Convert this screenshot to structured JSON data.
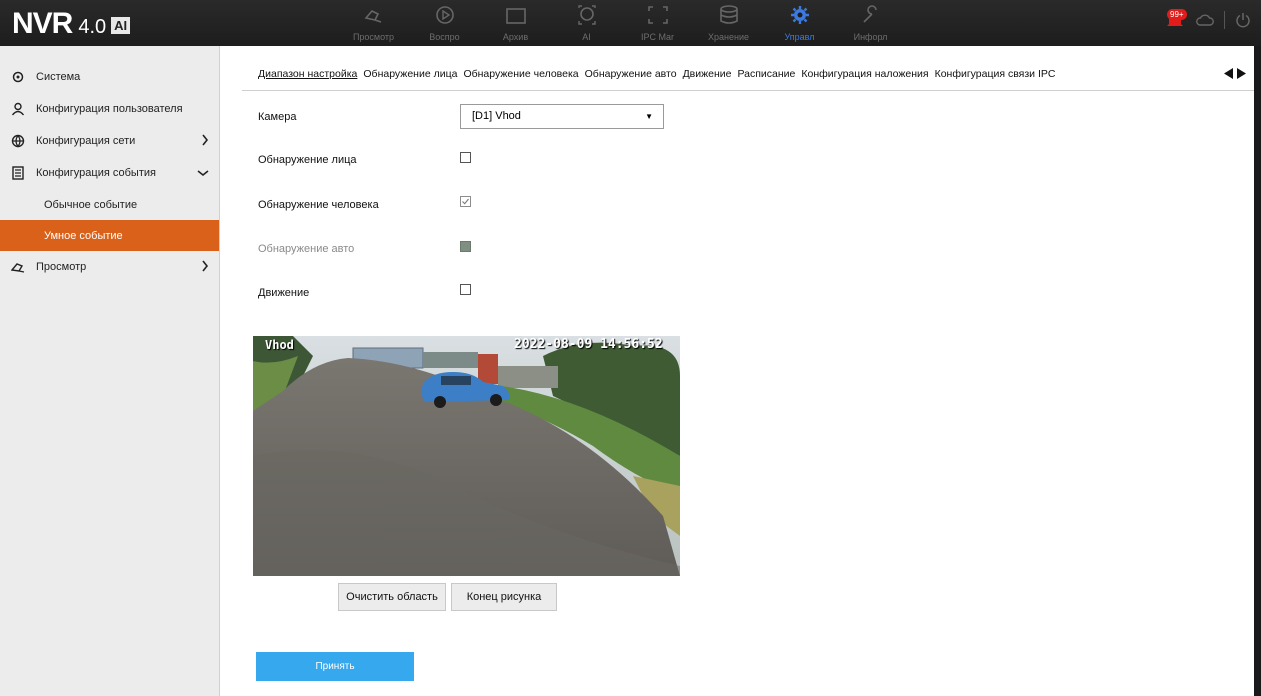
{
  "header": {
    "logo_main": "NVR",
    "logo_version": "4.0",
    "logo_ai": "AI",
    "nav": [
      {
        "label": "Просмотр",
        "icon": "live-view-icon"
      },
      {
        "label": "Воспро",
        "icon": "playback-icon"
      },
      {
        "label": "Архив",
        "icon": "archive-icon"
      },
      {
        "label": "AI",
        "icon": "ai-face-icon"
      },
      {
        "label": "IPC Mar",
        "icon": "ipc-manage-icon"
      },
      {
        "label": "Хранение",
        "icon": "storage-icon"
      },
      {
        "label": "Управл",
        "icon": "gear-icon",
        "active": true
      },
      {
        "label": "Инфорл",
        "icon": "info-wrench-icon"
      }
    ],
    "alarm_badge": "99+"
  },
  "sidebar": {
    "items": [
      {
        "label": "Система",
        "icon": "gear-icon"
      },
      {
        "label": "Конфигурация пользователя",
        "icon": "user-icon"
      },
      {
        "label": "Конфигурация сети",
        "icon": "globe-icon"
      },
      {
        "label": "Конфигурация события",
        "icon": "document-icon"
      },
      {
        "label": "Просмотр",
        "icon": "camera-icon"
      }
    ],
    "subitems": [
      {
        "label": "Обычное событие"
      },
      {
        "label": "Умное событие",
        "active": true
      }
    ]
  },
  "tabs": [
    {
      "label": "Диапазон настройка",
      "active": true
    },
    {
      "label": "Обнаружение лица"
    },
    {
      "label": "Обнаружение человека"
    },
    {
      "label": "Обнаружение авто"
    },
    {
      "label": "Движение"
    },
    {
      "label": "Расписание"
    },
    {
      "label": "Конфигурация наложения"
    },
    {
      "label": "Конфигурация связи IPC"
    }
  ],
  "form": {
    "camera_label": "Камера",
    "camera_value": "[D1] Vhod",
    "face_label": "Обнаружение лица",
    "face_checked": false,
    "human_label": "Обнаружение человека",
    "human_checked": true,
    "vehicle_label": "Обнаружение авто",
    "vehicle_disabled": true,
    "motion_label": "Движение",
    "motion_checked": false
  },
  "video": {
    "channel_name": "Vhod",
    "timestamp": "2022-08-09 14:56:52"
  },
  "buttons": {
    "clear_area": "Очистить область",
    "end_drawing": "Конец рисунка",
    "apply": "Принять"
  },
  "colors": {
    "accent_orange": "#d9611a",
    "apply_blue": "#35a8ee",
    "active_nav_blue": "#3c7ae0",
    "alarm_red": "#e21b1b"
  }
}
